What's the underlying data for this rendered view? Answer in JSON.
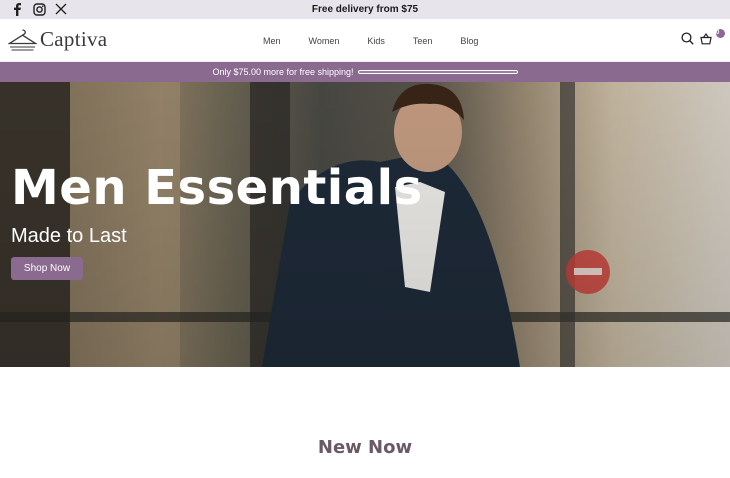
{
  "topbar": {
    "promo": "Free delivery from $75",
    "social": [
      "facebook-icon",
      "instagram-icon",
      "x-icon"
    ]
  },
  "header": {
    "logo_text": "Captiva",
    "nav": [
      "Men",
      "Women",
      "Kids",
      "Teen",
      "Blog"
    ],
    "cart_count": "0"
  },
  "shipping": {
    "message": "Only $75.00 more for free shipping!",
    "progress": 0
  },
  "hero": {
    "title": "Men Essentials",
    "subtitle": "Made to Last",
    "cta": "Shop Now"
  },
  "section": {
    "title": "New Now"
  },
  "colors": {
    "accent": "#8a6a8f",
    "topbar_bg": "#e8e4eb",
    "section_title": "#6a5a68"
  }
}
